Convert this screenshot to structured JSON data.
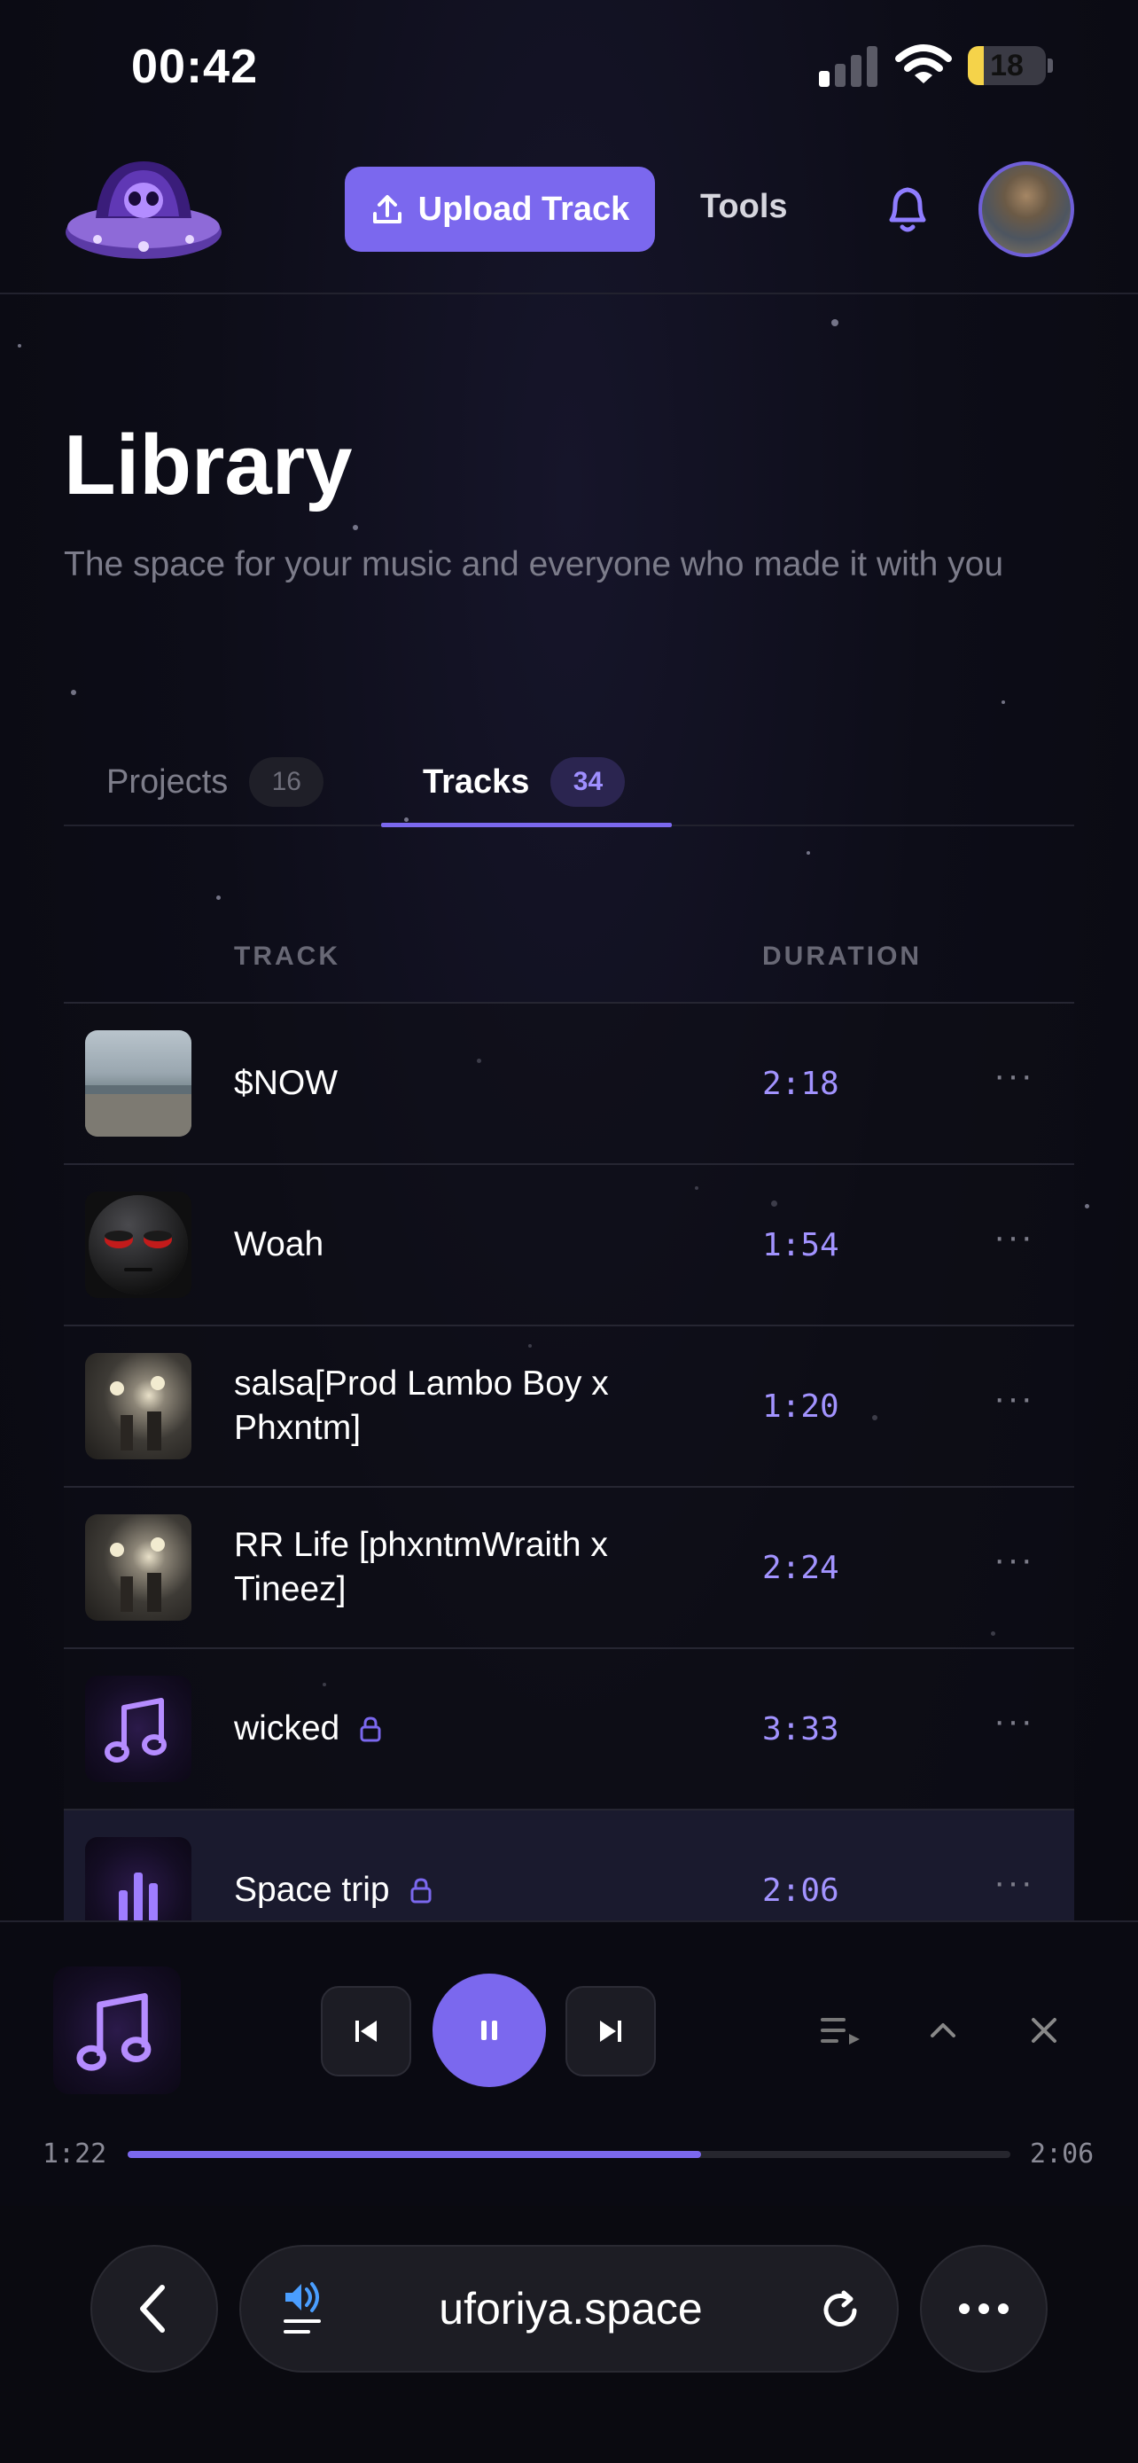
{
  "status_bar": {
    "time": "00:42",
    "battery": "18"
  },
  "header": {
    "upload_label": "Upload Track",
    "tools_label": "Tools"
  },
  "page": {
    "title": "Library",
    "subtitle": "The space for your music and everyone who made it with you"
  },
  "tabs": [
    {
      "label": "Projects",
      "count": "16",
      "active": false
    },
    {
      "label": "Tracks",
      "count": "34",
      "active": true
    }
  ],
  "table": {
    "headers": {
      "track": "TRACK",
      "duration": "DURATION"
    },
    "rows": [
      {
        "name": "$NOW",
        "duration": "2:18",
        "locked": false,
        "art": "beach-photo"
      },
      {
        "name": "Woah",
        "duration": "1:54",
        "locked": false,
        "art": "red-eyes-emoji"
      },
      {
        "name": "salsa[Prod Lambo Boy x Phxntm]",
        "duration": "1:20",
        "locked": false,
        "art": "studio-photo"
      },
      {
        "name": "RR Life [phxntmWraith x Tineez]",
        "duration": "2:24",
        "locked": false,
        "art": "studio-photo"
      },
      {
        "name": "wicked",
        "duration": "3:33",
        "locked": true,
        "art": "music-note-icon"
      },
      {
        "name": "Space trip",
        "duration": "2:06",
        "locked": true,
        "art": "bars-icon"
      }
    ],
    "more_label": "···"
  },
  "player": {
    "current_time": "1:22",
    "total_time": "2:06",
    "progress": 0.65
  },
  "browser": {
    "url": "uforiya.space"
  },
  "colors": {
    "accent": "#7b68ee",
    "duration_text": "#a293ff",
    "background": "#0b0b12"
  }
}
